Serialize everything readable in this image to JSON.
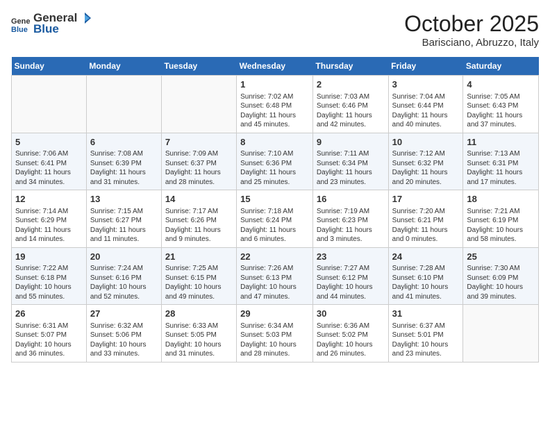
{
  "header": {
    "logo_general": "General",
    "logo_blue": "Blue",
    "month": "October 2025",
    "location": "Barisciano, Abruzzo, Italy"
  },
  "columns": [
    "Sunday",
    "Monday",
    "Tuesday",
    "Wednesday",
    "Thursday",
    "Friday",
    "Saturday"
  ],
  "weeks": [
    [
      {
        "day": "",
        "info": ""
      },
      {
        "day": "",
        "info": ""
      },
      {
        "day": "",
        "info": ""
      },
      {
        "day": "1",
        "info": "Sunrise: 7:02 AM\nSunset: 6:48 PM\nDaylight: 11 hours and 45 minutes."
      },
      {
        "day": "2",
        "info": "Sunrise: 7:03 AM\nSunset: 6:46 PM\nDaylight: 11 hours and 42 minutes."
      },
      {
        "day": "3",
        "info": "Sunrise: 7:04 AM\nSunset: 6:44 PM\nDaylight: 11 hours and 40 minutes."
      },
      {
        "day": "4",
        "info": "Sunrise: 7:05 AM\nSunset: 6:43 PM\nDaylight: 11 hours and 37 minutes."
      }
    ],
    [
      {
        "day": "5",
        "info": "Sunrise: 7:06 AM\nSunset: 6:41 PM\nDaylight: 11 hours and 34 minutes."
      },
      {
        "day": "6",
        "info": "Sunrise: 7:08 AM\nSunset: 6:39 PM\nDaylight: 11 hours and 31 minutes."
      },
      {
        "day": "7",
        "info": "Sunrise: 7:09 AM\nSunset: 6:37 PM\nDaylight: 11 hours and 28 minutes."
      },
      {
        "day": "8",
        "info": "Sunrise: 7:10 AM\nSunset: 6:36 PM\nDaylight: 11 hours and 25 minutes."
      },
      {
        "day": "9",
        "info": "Sunrise: 7:11 AM\nSunset: 6:34 PM\nDaylight: 11 hours and 23 minutes."
      },
      {
        "day": "10",
        "info": "Sunrise: 7:12 AM\nSunset: 6:32 PM\nDaylight: 11 hours and 20 minutes."
      },
      {
        "day": "11",
        "info": "Sunrise: 7:13 AM\nSunset: 6:31 PM\nDaylight: 11 hours and 17 minutes."
      }
    ],
    [
      {
        "day": "12",
        "info": "Sunrise: 7:14 AM\nSunset: 6:29 PM\nDaylight: 11 hours and 14 minutes."
      },
      {
        "day": "13",
        "info": "Sunrise: 7:15 AM\nSunset: 6:27 PM\nDaylight: 11 hours and 11 minutes."
      },
      {
        "day": "14",
        "info": "Sunrise: 7:17 AM\nSunset: 6:26 PM\nDaylight: 11 hours and 9 minutes."
      },
      {
        "day": "15",
        "info": "Sunrise: 7:18 AM\nSunset: 6:24 PM\nDaylight: 11 hours and 6 minutes."
      },
      {
        "day": "16",
        "info": "Sunrise: 7:19 AM\nSunset: 6:23 PM\nDaylight: 11 hours and 3 minutes."
      },
      {
        "day": "17",
        "info": "Sunrise: 7:20 AM\nSunset: 6:21 PM\nDaylight: 11 hours and 0 minutes."
      },
      {
        "day": "18",
        "info": "Sunrise: 7:21 AM\nSunset: 6:19 PM\nDaylight: 10 hours and 58 minutes."
      }
    ],
    [
      {
        "day": "19",
        "info": "Sunrise: 7:22 AM\nSunset: 6:18 PM\nDaylight: 10 hours and 55 minutes."
      },
      {
        "day": "20",
        "info": "Sunrise: 7:24 AM\nSunset: 6:16 PM\nDaylight: 10 hours and 52 minutes."
      },
      {
        "day": "21",
        "info": "Sunrise: 7:25 AM\nSunset: 6:15 PM\nDaylight: 10 hours and 49 minutes."
      },
      {
        "day": "22",
        "info": "Sunrise: 7:26 AM\nSunset: 6:13 PM\nDaylight: 10 hours and 47 minutes."
      },
      {
        "day": "23",
        "info": "Sunrise: 7:27 AM\nSunset: 6:12 PM\nDaylight: 10 hours and 44 minutes."
      },
      {
        "day": "24",
        "info": "Sunrise: 7:28 AM\nSunset: 6:10 PM\nDaylight: 10 hours and 41 minutes."
      },
      {
        "day": "25",
        "info": "Sunrise: 7:30 AM\nSunset: 6:09 PM\nDaylight: 10 hours and 39 minutes."
      }
    ],
    [
      {
        "day": "26",
        "info": "Sunrise: 6:31 AM\nSunset: 5:07 PM\nDaylight: 10 hours and 36 minutes."
      },
      {
        "day": "27",
        "info": "Sunrise: 6:32 AM\nSunset: 5:06 PM\nDaylight: 10 hours and 33 minutes."
      },
      {
        "day": "28",
        "info": "Sunrise: 6:33 AM\nSunset: 5:05 PM\nDaylight: 10 hours and 31 minutes."
      },
      {
        "day": "29",
        "info": "Sunrise: 6:34 AM\nSunset: 5:03 PM\nDaylight: 10 hours and 28 minutes."
      },
      {
        "day": "30",
        "info": "Sunrise: 6:36 AM\nSunset: 5:02 PM\nDaylight: 10 hours and 26 minutes."
      },
      {
        "day": "31",
        "info": "Sunrise: 6:37 AM\nSunset: 5:01 PM\nDaylight: 10 hours and 23 minutes."
      },
      {
        "day": "",
        "info": ""
      }
    ]
  ]
}
